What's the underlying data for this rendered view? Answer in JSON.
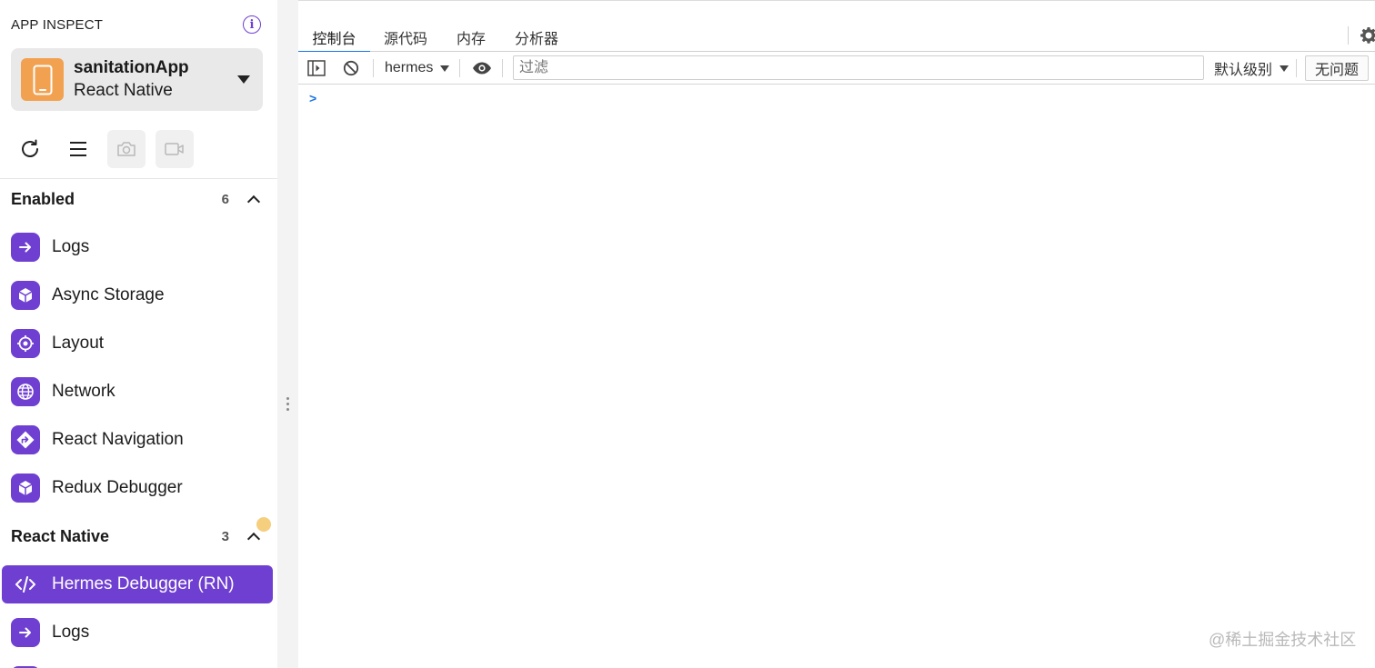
{
  "sidebar": {
    "app_title": "APP INSPECT",
    "info_icon": "info-icon",
    "app": {
      "name": "sanitationApp",
      "platform": "React Native",
      "icon": "tablet-icon",
      "icon_color": "#f1a150"
    },
    "toolbar": {
      "icons": [
        "refresh-icon",
        "menu-icon",
        "camera-icon",
        "video-camera-icon"
      ]
    },
    "sections": [
      {
        "title": "Enabled",
        "count": "6",
        "items": [
          {
            "label": "Logs",
            "icon": "arrow-right-icon"
          },
          {
            "label": "Async Storage",
            "icon": "cube-icon"
          },
          {
            "label": "Layout",
            "icon": "target-icon"
          },
          {
            "label": "Network",
            "icon": "globe-icon"
          },
          {
            "label": "React Navigation",
            "icon": "direction-sign-icon"
          },
          {
            "label": "Redux Debugger",
            "icon": "cube-icon"
          }
        ]
      },
      {
        "title": "React Native",
        "count": "3",
        "items": [
          {
            "label": "Hermes Debugger (RN)",
            "icon": "code-icon",
            "active": true
          },
          {
            "label": "Logs",
            "icon": "arrow-right-icon"
          }
        ]
      }
    ],
    "accent_color": "#6f3fd1",
    "notification_dot_color": "#f5cf7e"
  },
  "devtools": {
    "tabs": [
      {
        "label": "控制台",
        "active": true
      },
      {
        "label": "源代码"
      },
      {
        "label": "内存"
      },
      {
        "label": "分析器"
      }
    ],
    "settings_icon": "gear-icon",
    "console_toolbar": {
      "sidebar_toggle_icon": "sidebar-toggle-icon",
      "clear_icon": "clear-console-icon",
      "context": "hermes",
      "live_expression_icon": "eye-icon",
      "filter_placeholder": "过滤",
      "log_level": "默认级别",
      "issues_label": "无问题"
    },
    "prompt_symbol": ">"
  },
  "watermark": "@稀土掘金技术社区"
}
